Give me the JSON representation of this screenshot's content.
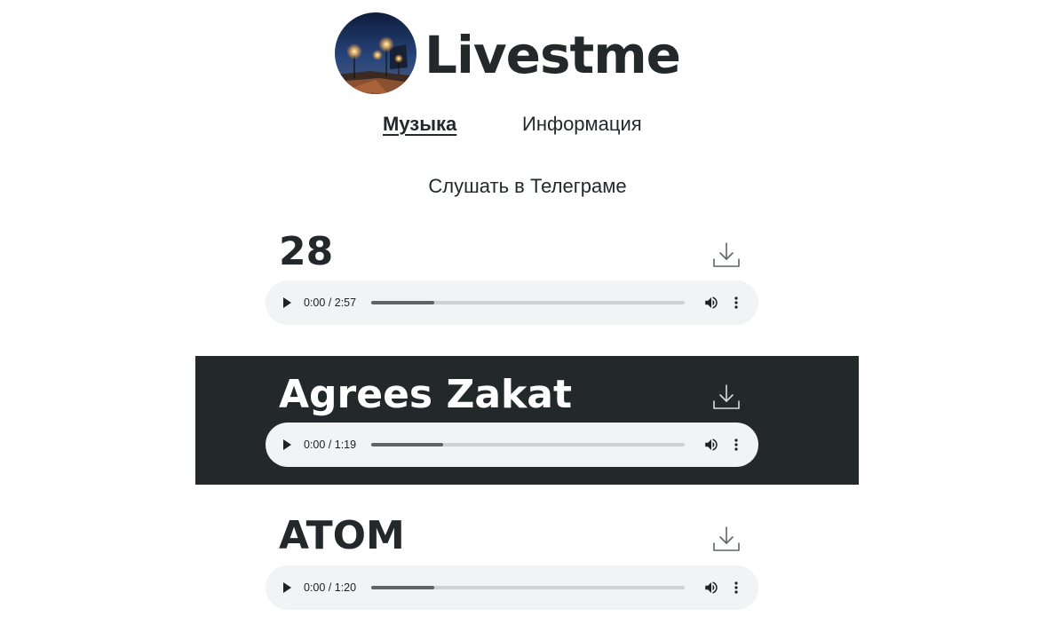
{
  "header": {
    "brand": "Livestme",
    "avatar_icon": "night-city-photo"
  },
  "nav": {
    "music": "Музыка",
    "info": "Информация"
  },
  "listen_link": "Слушать в Телеграме",
  "tracks": [
    {
      "title": "28",
      "time": "0:00 / 2:57",
      "buffered_fraction": 0.2
    },
    {
      "title": "Agrees Zakat",
      "time": "0:00 / 1:19",
      "buffered_fraction": 0.23
    },
    {
      "title": "ATOM",
      "time": "0:00 / 1:20",
      "buffered_fraction": 0.2
    }
  ],
  "colors": {
    "text": "#23292b",
    "dark_band": "#23292b",
    "player_bg": "#f1f3f4",
    "progress": "#5f6368"
  },
  "icons": {
    "download": "download-icon",
    "play": "play-icon",
    "volume": "volume-icon",
    "more": "more-vertical-icon"
  }
}
